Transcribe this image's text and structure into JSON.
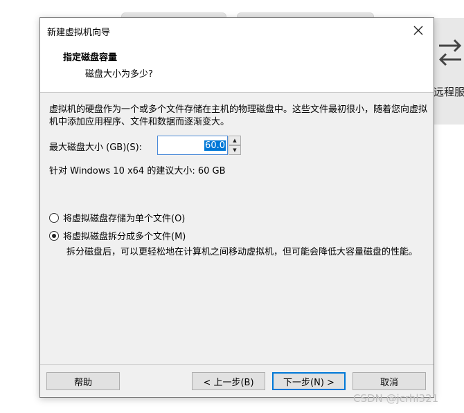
{
  "background": {
    "panel_label": "远程服",
    "watermark": "CSDN @jcrhl321"
  },
  "dialog": {
    "title": "新建虚拟机向导",
    "header": {
      "title": "指定磁盘容量",
      "subtitle": "磁盘大小为多少?"
    },
    "description": "虚拟机的硬盘作为一个或多个文件存储在主机的物理磁盘中。这些文件最初很小，随着您向虚拟机中添加应用程序、文件和数据而逐渐变大。",
    "max_size_label": "最大磁盘大小 (GB)(S):",
    "max_size_value": "60.0",
    "recommendation": "针对 Windows 10 x64 的建议大小: 60 GB",
    "options": {
      "single_label": "将虚拟磁盘存储为单个文件(O)",
      "single_checked": false,
      "multi_label": "将虚拟磁盘拆分成多个文件(M)",
      "multi_checked": true,
      "multi_description": "拆分磁盘后，可以更轻松地在计算机之间移动虚拟机，但可能会降低大容量磁盘的性能。"
    },
    "buttons": {
      "help": "帮助",
      "back": "< 上一步(B)",
      "next": "下一步(N) >",
      "cancel": "取消"
    }
  },
  "icons": {
    "close": "close-icon",
    "spin_up": "spin-up-icon",
    "spin_down": "spin-down-icon",
    "swap": "swap-arrows-icon"
  },
  "colors": {
    "accent": "#0078d7",
    "dialog_bg": "#f0f0f0",
    "header_bg": "#ffffff"
  }
}
